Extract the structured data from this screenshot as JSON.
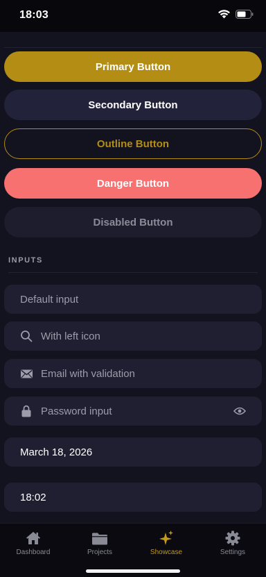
{
  "status_bar": {
    "time": "18:03",
    "icons": [
      "wifi-icon",
      "battery-icon"
    ]
  },
  "buttons": {
    "primary": "Primary Button",
    "secondary": "Secondary Button",
    "outline": "Outline Button",
    "danger": "Danger Button",
    "disabled": "Disabled Button"
  },
  "inputs_section": {
    "title": "INPUTS",
    "default_placeholder": "Default input",
    "search_placeholder": "With left icon",
    "email_placeholder": "Email with validation",
    "password_placeholder": "Password input",
    "date_value": "March 18, 2026",
    "time_value": "18:02"
  },
  "tab_bar": {
    "tabs": [
      {
        "label": "Dashboard",
        "icon": "home-icon"
      },
      {
        "label": "Projects",
        "icon": "folder-icon"
      },
      {
        "label": "Showcase",
        "icon": "sparkles-icon",
        "active": true
      },
      {
        "label": "Settings",
        "icon": "gear-icon"
      }
    ]
  },
  "colors": {
    "background": "#13131f",
    "accent": "#b38d14",
    "danger": "#f87171",
    "surface": "#1f1f31"
  }
}
